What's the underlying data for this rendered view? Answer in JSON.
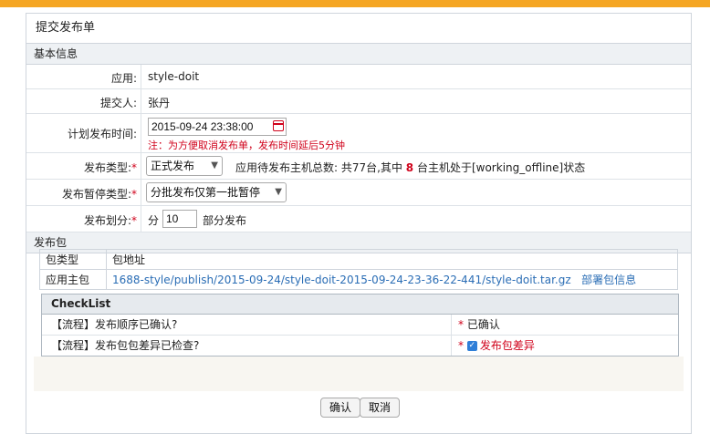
{
  "page": {
    "title": "提交发布单"
  },
  "basic": {
    "heading": "基本信息",
    "app": {
      "label": "应用:",
      "value": "style-doit"
    },
    "submitter": {
      "label": "提交人:",
      "value": "张丹"
    },
    "plan_time": {
      "label": "计划发布时间:",
      "value": "2015-09-24 23:38:00",
      "hint": "注：为方便取消发布单，发布时间延后5分钟"
    },
    "release_type": {
      "label": "发布类型:",
      "required_mark": "*",
      "selected": "正式发布",
      "host_info_prefix": "应用待发布主机总数: 共77台,其中",
      "offline_count": "8",
      "host_info_suffix": "台主机处于[working_offline]状态"
    },
    "pause_type": {
      "label": "发布暂停类型:",
      "required_mark": "*",
      "selected": "分批发布仅第一批暂停"
    },
    "partition": {
      "label": "发布划分:",
      "required_mark": "*",
      "prefix": "分",
      "value": "10",
      "suffix": "部分发布"
    }
  },
  "package": {
    "heading": "发布包",
    "columns": [
      "包类型",
      "包地址"
    ],
    "rows": [
      {
        "type": "应用主包",
        "url": "1688-style/publish/2015-09-24/style-doit-2015-09-24-23-36-22-441/style-doit.tar.gz",
        "action": "部署包信息"
      }
    ]
  },
  "checklist": {
    "title": "CheckList",
    "items": [
      {
        "question": "【流程】发布顺序已确认?",
        "required_mark": "*",
        "answer": "已确认"
      },
      {
        "question": "【流程】发布包包差异已检查?",
        "required_mark": "*",
        "answer": "发布包差异",
        "checked": true
      }
    ]
  },
  "buttons": {
    "confirm": "确认",
    "cancel": "取消"
  },
  "colors": {
    "accent_bar": "#f5a623",
    "required": "#d0021b",
    "link": "#2a6db5",
    "checkbox": "#2f7fd8"
  }
}
